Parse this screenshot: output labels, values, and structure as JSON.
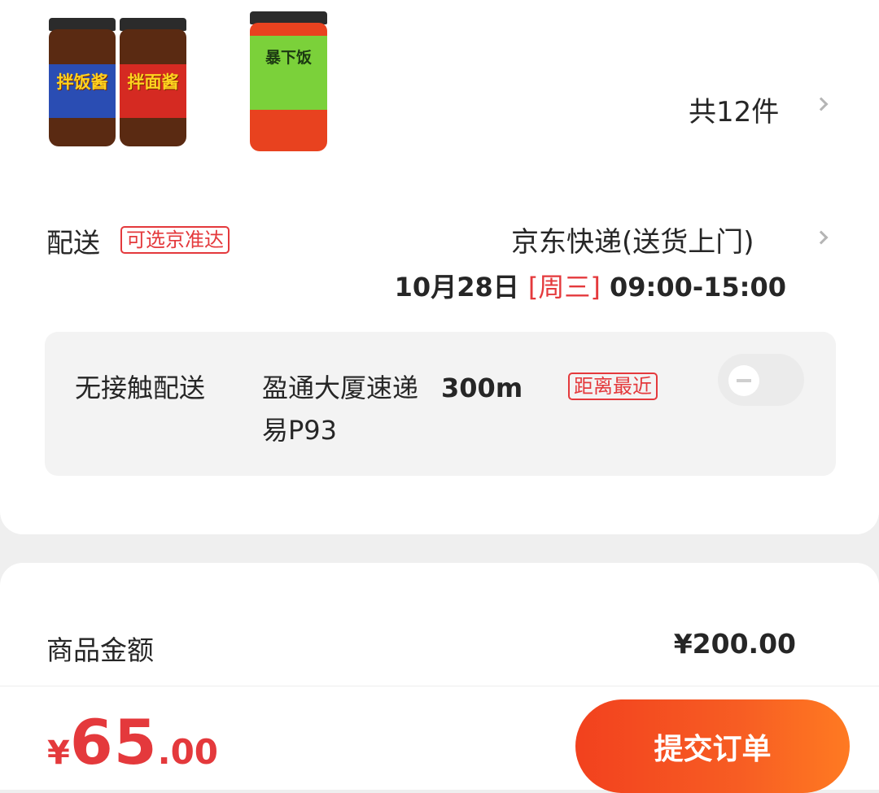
{
  "products": {
    "items": [
      {
        "name": "拌饭酱",
        "color": "#2a4db3"
      },
      {
        "name": "拌面酱",
        "color": "#d52a22"
      },
      {
        "name": "暴下饭",
        "color": "#7bd13a"
      }
    ],
    "count_text": "共12件"
  },
  "delivery": {
    "label": "配送",
    "tag": "可选京准达",
    "method": "京东快递(送货上门)",
    "date": "10月28日",
    "weekday": "[周三]",
    "time": "09:00-15:00"
  },
  "contactless": {
    "label": "无接触配送",
    "location_line1": "盈通大厦速递",
    "distance": "300m",
    "tag": "距离最近",
    "location_line2": "易P93",
    "enabled": false
  },
  "summary": {
    "amount_label": "商品金额",
    "amount_value": "¥200.00"
  },
  "footer": {
    "currency": "¥",
    "total_int": "65",
    "total_dec": ".00",
    "submit_label": "提交订单"
  },
  "colors": {
    "accent": "#e4393c",
    "button_start": "#f2411e",
    "button_end": "#ff7a22"
  }
}
